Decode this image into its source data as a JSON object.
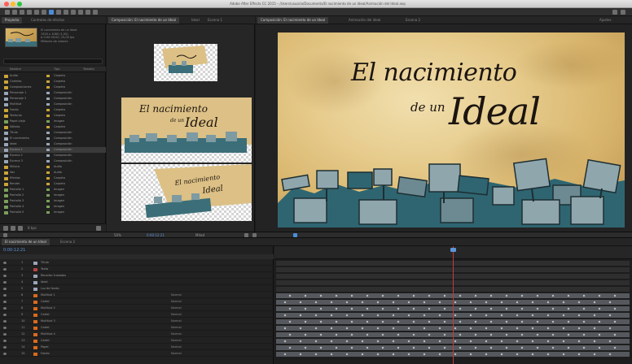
{
  "window": {
    "title": "Adobe After Effects CC 2015 – /Users/usuario/Documents/El nacimiento de un Ideal/Animación del Ideal.aep",
    "traffic_lights": [
      "#ff5f57",
      "#febc2e",
      "#28c840"
    ]
  },
  "project_panel": {
    "tabs": [
      "Proyecto",
      "Controles de efectos"
    ],
    "info_lines": [
      "El nacimiento de un Ideal",
      "1920 x 1080 (1,00)",
      "Δ 0:00:30:00, 25,00 fps",
      "Millones de colores"
    ],
    "search_placeholder": "",
    "columns": [
      "Nombre",
      "Tipo",
      "Tamaño"
    ],
    "items": [
      {
        "name": "Audio",
        "type": "Carpeta",
        "size": "",
        "color": "#caa536"
      },
      {
        "name": "Carteles",
        "type": "Carpeta",
        "size": "",
        "color": "#caa536"
      },
      {
        "name": "Composiciones",
        "type": "Carpeta",
        "size": "",
        "color": "#caa536"
      },
      {
        "name": "Personaje 1",
        "type": "Composición",
        "size": "",
        "color": "#9aa6b8"
      },
      {
        "name": "Personaje 2",
        "type": "Composición",
        "size": "",
        "color": "#9aa6b8"
      },
      {
        "name": "Multitud",
        "type": "Composición",
        "size": "",
        "color": "#9aa6b8"
      },
      {
        "name": "Fondo",
        "type": "Carpeta",
        "size": "",
        "color": "#caa536"
      },
      {
        "name": "Texturas",
        "type": "Carpeta",
        "size": "",
        "color": "#caa536"
      },
      {
        "name": "Papel viejo",
        "type": "Imagen",
        "size": "",
        "color": "#7ba05b"
      },
      {
        "name": "Sólidos",
        "type": "Carpeta",
        "size": "",
        "color": "#caa536"
      },
      {
        "name": "Título",
        "type": "Composición",
        "size": "",
        "color": "#9aa6b8"
      },
      {
        "name": "El nacimiento",
        "type": "Composición",
        "size": "",
        "color": "#9aa6b8"
      },
      {
        "name": "Ideal",
        "type": "Composición",
        "size": "",
        "color": "#9aa6b8"
      },
      {
        "name": "Escena 1",
        "type": "Composición",
        "size": "",
        "color": "#9aa6b8"
      },
      {
        "name": "Escena 2",
        "type": "Composición",
        "size": "",
        "color": "#9aa6b8"
      },
      {
        "name": "Escena 3",
        "type": "Composición",
        "size": "",
        "color": "#9aa6b8"
      },
      {
        "name": "Música",
        "type": "Audio",
        "size": "",
        "color": "#caa536"
      },
      {
        "name": "Voz",
        "type": "Audio",
        "size": "",
        "color": "#caa536"
      },
      {
        "name": "Efectos",
        "type": "Carpeta",
        "size": "",
        "color": "#caa536"
      },
      {
        "name": "Render",
        "type": "Carpeta",
        "size": "",
        "color": "#caa536"
      },
      {
        "name": "Pantalla 1",
        "type": "Imagen",
        "size": "",
        "color": "#7ba05b"
      },
      {
        "name": "Pantalla 2",
        "type": "Imagen",
        "size": "",
        "color": "#7ba05b"
      },
      {
        "name": "Pantalla 3",
        "type": "Imagen",
        "size": "",
        "color": "#7ba05b"
      },
      {
        "name": "Pantalla 4",
        "type": "Imagen",
        "size": "",
        "color": "#7ba05b"
      },
      {
        "name": "Pantalla 5",
        "type": "Imagen",
        "size": "",
        "color": "#7ba05b"
      }
    ],
    "footer_bpc": "8 bpc"
  },
  "layer_panel": {
    "tabs": [
      "Composición: El nacimiento de un Ideal",
      "Ideal",
      "Escena 1"
    ]
  },
  "viewer": {
    "tabs": [
      "Composición: El nacimiento de un Ideal",
      "Animación del ideal",
      "Escena 2"
    ],
    "right_label": "Ajustes",
    "title_line1": "El nacimiento",
    "title_line2": "de un",
    "title_line3": "Ideal",
    "zoom": "50%",
    "timecode": "0:00:12:21",
    "resolution": "Mitad"
  },
  "timeline": {
    "tabs": [
      "El nacimiento de un Ideal",
      "Escena 2"
    ],
    "timecode": "0:00:12:21",
    "layers": [
      {
        "num": "1",
        "name": "Título",
        "value": "",
        "mode": "",
        "tc": "",
        "color": "#9aa6b8"
      },
      {
        "num": "2",
        "name": "Texto",
        "value": "",
        "mode": "",
        "tc": "",
        "color": "#b24444"
      },
      {
        "num": "3",
        "name": "Recortar trazados",
        "value": "",
        "mode": "",
        "tc": "",
        "color": "#9aa6b8"
      },
      {
        "num": "4",
        "name": "Ideal",
        "value": "",
        "mode": "",
        "tc": "",
        "color": "#9aa6b8"
      },
      {
        "num": "5",
        "name": "Luz de fondo",
        "value": "",
        "mode": "",
        "tc": "",
        "color": "#9aa6b8"
      },
      {
        "num": "6",
        "name": "Multitud 1",
        "value": "",
        "mode": "Normal",
        "tc": "",
        "color": "#d86a1e"
      },
      {
        "num": "7",
        "name": "Cartel",
        "value": "",
        "mode": "Normal",
        "tc": "",
        "color": "#d86a1e"
      },
      {
        "num": "8",
        "name": "Multitud 2",
        "value": "",
        "mode": "Normal",
        "tc": "",
        "color": "#d86a1e"
      },
      {
        "num": "9",
        "name": "Cartel",
        "value": "",
        "mode": "Normal",
        "tc": "",
        "color": "#d86a1e"
      },
      {
        "num": "10",
        "name": "Multitud 3",
        "value": "",
        "mode": "Normal",
        "tc": "",
        "color": "#d86a1e"
      },
      {
        "num": "11",
        "name": "Cartel",
        "value": "",
        "mode": "Normal",
        "tc": "",
        "color": "#d86a1e"
      },
      {
        "num": "12",
        "name": "Multitud 4",
        "value": "",
        "mode": "Normal",
        "tc": "",
        "color": "#d86a1e"
      },
      {
        "num": "13",
        "name": "Cartel",
        "value": "",
        "mode": "Normal",
        "tc": "",
        "color": "#d86a1e"
      },
      {
        "num": "14",
        "name": "Papel",
        "value": "",
        "mode": "Normal",
        "tc": "",
        "color": "#d86a1e"
      },
      {
        "num": "15",
        "name": "Fondo",
        "value": "",
        "mode": "Normal",
        "tc": "",
        "color": "#d86a1e"
      }
    ]
  },
  "colors": {
    "accent": "#5c95d9",
    "playhead": "#c23b3b",
    "teal": "#3b6e78",
    "parchment": "#e6cb8c"
  }
}
